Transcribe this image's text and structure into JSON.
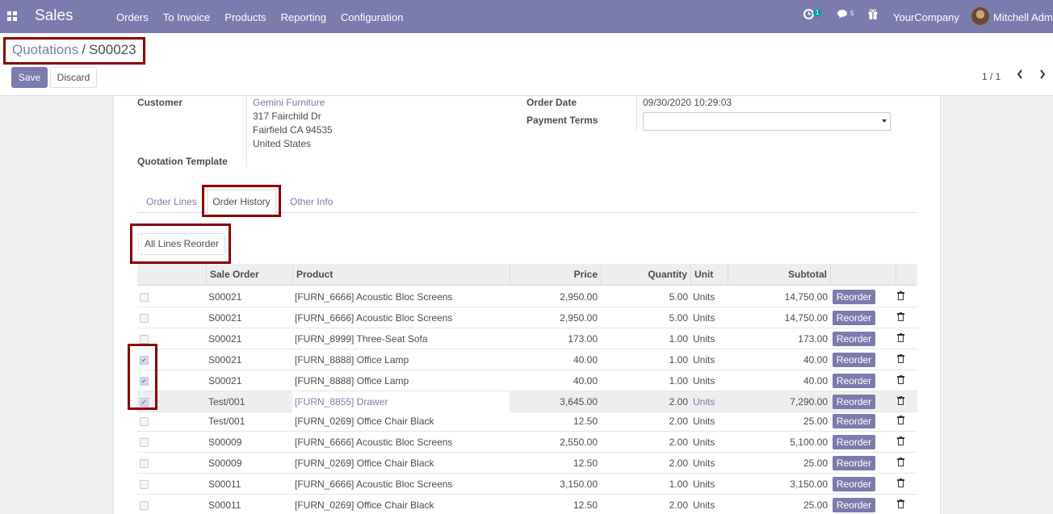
{
  "navbar": {
    "app_name": "Sales",
    "menu": [
      "Orders",
      "To Invoice",
      "Products",
      "Reporting",
      "Configuration"
    ],
    "activity_badge": "1",
    "messages_badge": "5",
    "company": "YourCompany",
    "user": "Mitchell Admin",
    "accent_color": "#7c7bad"
  },
  "control_panel": {
    "breadcrumb_parent": "Quotations",
    "breadcrumb_separator": "/",
    "breadcrumb_current": "S00023",
    "save_label": "Save",
    "discard_label": "Discard",
    "pager": "1 / 1"
  },
  "form": {
    "customer_label": "Customer",
    "customer_name": "Gemini Furniture",
    "address_line1": "317 Fairchild Dr",
    "address_line2": "Fairfield CA 94535",
    "address_line3": "United States",
    "quotation_template_label": "Quotation Template",
    "order_date_label": "Order Date",
    "order_date_value": "09/30/2020 10:29:03",
    "payment_terms_label": "Payment Terms",
    "payment_terms_value": ""
  },
  "tabs": {
    "order_lines": "Order Lines",
    "order_history": "Order History",
    "other_info": "Other Info"
  },
  "all_lines_reorder_label": "All Lines Reorder",
  "table": {
    "headers": {
      "sale_order": "Sale Order",
      "product": "Product",
      "price": "Price",
      "quantity": "Quantity",
      "unit": "Unit",
      "subtotal": "Subtotal"
    },
    "reorder_label": "Reorder",
    "rows": [
      {
        "checked": false,
        "sale_order": "S00021",
        "product": "[FURN_6666] Acoustic Bloc Screens",
        "price": "2,950.00",
        "quantity": "5.00",
        "unit": "Units",
        "subtotal": "14,750.00"
      },
      {
        "checked": false,
        "sale_order": "S00021",
        "product": "[FURN_6666] Acoustic Bloc Screens",
        "price": "2,950.00",
        "quantity": "5.00",
        "unit": "Units",
        "subtotal": "14,750.00"
      },
      {
        "checked": false,
        "sale_order": "S00021",
        "product": "[FURN_8999] Three-Seat Sofa",
        "price": "173.00",
        "quantity": "1.00",
        "unit": "Units",
        "subtotal": "173.00"
      },
      {
        "checked": true,
        "sale_order": "S00021",
        "product": "[FURN_8888] Office Lamp",
        "price": "40.00",
        "quantity": "1.00",
        "unit": "Units",
        "subtotal": "40.00"
      },
      {
        "checked": true,
        "sale_order": "S00021",
        "product": "[FURN_8888] Office Lamp",
        "price": "40.00",
        "quantity": "1.00",
        "unit": "Units",
        "subtotal": "40.00"
      },
      {
        "checked": true,
        "sale_order": "Test/001",
        "product": "[FURN_8855] Drawer",
        "price": "3,645.00",
        "quantity": "2.00",
        "unit": "Units",
        "subtotal": "7,290.00",
        "highlight": true
      },
      {
        "checked": false,
        "sale_order": "Test/001",
        "product": "[FURN_0269] Office Chair Black",
        "price": "12.50",
        "quantity": "2.00",
        "unit": "Units",
        "subtotal": "25.00"
      },
      {
        "checked": false,
        "sale_order": "S00009",
        "product": "[FURN_6666] Acoustic Bloc Screens",
        "price": "2,550.00",
        "quantity": "2.00",
        "unit": "Units",
        "subtotal": "5,100.00"
      },
      {
        "checked": false,
        "sale_order": "S00009",
        "product": "[FURN_0269] Office Chair Black",
        "price": "12.50",
        "quantity": "2.00",
        "unit": "Units",
        "subtotal": "25.00"
      },
      {
        "checked": false,
        "sale_order": "S00011",
        "product": "[FURN_6666] Acoustic Bloc Screens",
        "price": "3,150.00",
        "quantity": "1.00",
        "unit": "Units",
        "subtotal": "3,150.00"
      },
      {
        "checked": false,
        "sale_order": "S00011",
        "product": "[FURN_0269] Office Chair Black",
        "price": "12.50",
        "quantity": "2.00",
        "unit": "Units",
        "subtotal": "25.00"
      }
    ]
  }
}
